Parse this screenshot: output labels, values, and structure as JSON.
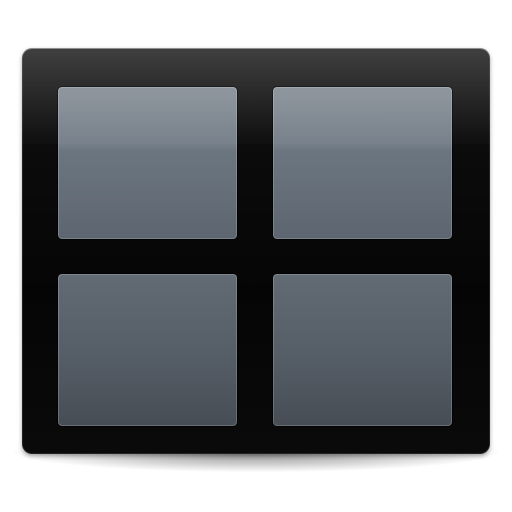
{
  "icon": {
    "name": "grid-view-icon",
    "tiles": [
      "top-left",
      "top-right",
      "bottom-left",
      "bottom-right"
    ],
    "colors": {
      "frame": "#050505",
      "tile_top": "#6c7681",
      "tile_bottom": "#555d66",
      "background": "#ffffff"
    }
  }
}
